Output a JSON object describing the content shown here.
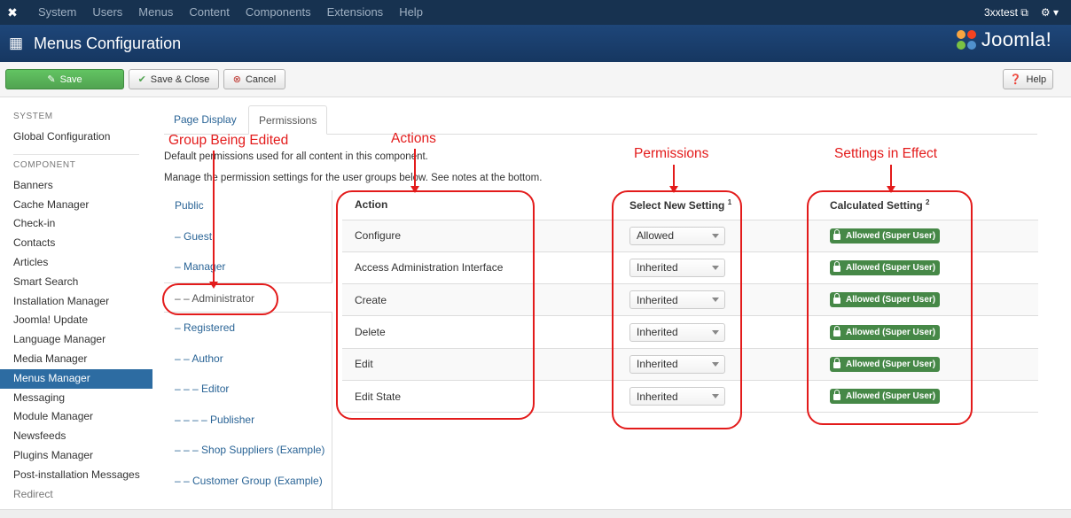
{
  "topbar": {
    "menu": [
      "System",
      "Users",
      "Menus",
      "Content",
      "Components",
      "Extensions",
      "Help"
    ],
    "site_name": "3xxtest",
    "settings": "⚙ ▾"
  },
  "header": {
    "title": "Menus Configuration",
    "brand": "Joomla!"
  },
  "toolbar": {
    "save": "Save",
    "save_close": "Save & Close",
    "cancel": "Cancel",
    "help": "Help"
  },
  "sidebar": {
    "system_heading": "SYSTEM",
    "global": "Global Configuration",
    "component_heading": "COMPONENT",
    "items": [
      "Banners",
      "Cache Manager",
      "Check-in",
      "Contacts",
      "Articles",
      "Smart Search",
      "Installation Manager",
      "Joomla! Update",
      "Language Manager",
      "Media Manager",
      "Menus Manager",
      "Messaging",
      "Module Manager",
      "Newsfeeds",
      "Plugins Manager",
      "Post-installation Messages",
      "Redirect"
    ]
  },
  "tabs": {
    "page_display": "Page Display",
    "permissions": "Permissions"
  },
  "content": {
    "desc1": "Default permissions used for all content in this component.",
    "desc2": "Manage the permission settings for the user groups below. See notes at the bottom."
  },
  "groups": [
    "Public",
    "– Guest",
    "– Manager",
    "– – Administrator",
    "– Registered",
    "– – Author",
    "– – – Editor",
    "– – – – Publisher",
    "– – – Shop Suppliers (Example)",
    "– – Customer Group (Example)"
  ],
  "table": {
    "col_action": "Action",
    "col_select": "Select New Setting",
    "col_select_sup": "1",
    "col_calc": "Calculated Setting",
    "col_calc_sup": "2",
    "rows": [
      {
        "action": "Configure",
        "setting": "Allowed",
        "calc": "Allowed (Super User)"
      },
      {
        "action": "Access Administration Interface",
        "setting": "Inherited",
        "calc": "Allowed (Super User)"
      },
      {
        "action": "Create",
        "setting": "Inherited",
        "calc": "Allowed (Super User)"
      },
      {
        "action": "Delete",
        "setting": "Inherited",
        "calc": "Allowed (Super User)"
      },
      {
        "action": "Edit",
        "setting": "Inherited",
        "calc": "Allowed (Super User)"
      },
      {
        "action": "Edit State",
        "setting": "Inherited",
        "calc": "Allowed (Super User)"
      }
    ]
  },
  "annotations": {
    "group": "Group Being Edited",
    "actions": "Actions",
    "permissions": "Permissions",
    "effect": "Settings in Effect"
  }
}
